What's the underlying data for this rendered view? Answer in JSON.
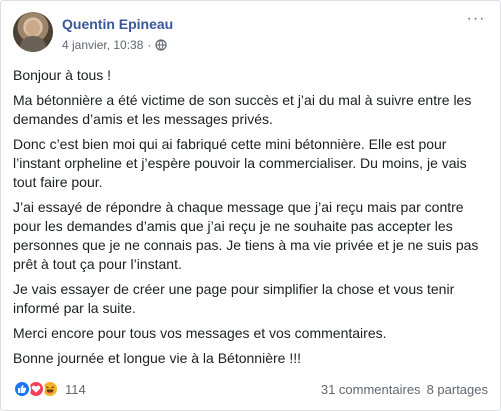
{
  "post": {
    "author": "Quentin Epineau",
    "date": "4 janvier, 10:38",
    "separator": "·",
    "privacy_icon": "globe-icon",
    "more_icon": "more-options-icon",
    "more_label": "···",
    "paragraphs": [
      "Bonjour à tous !",
      "Ma bétonnière a été victime de son succès et j’ai du mal à suivre entre les demandes d’amis et les messages privés.",
      "Donc c’est bien moi qui ai fabriqué cette mini bétonnière. Elle est pour l’instant orpheline et j’espère pouvoir la commercialiser. Du moins, je vais tout faire pour.",
      "J’ai essayé de répondre à chaque message que j’ai reçu mais par contre pour les demandes d’amis que j’ai reçu je ne souhaite pas accepter les personnes que je ne connais pas. Je tiens à ma vie privée et je ne suis pas prêt à tout ça pour l’instant.",
      "Je vais essayer de créer une page pour simplifier la chose et vous tenir informé par la suite.",
      "Merci encore pour tous vos messages et vos commentaires.",
      "Bonne journée et longue vie à la Bétonnière !!!"
    ]
  },
  "reactions": {
    "icons": [
      "like-icon",
      "love-icon",
      "haha-icon"
    ],
    "colors": {
      "like": "#1877f2",
      "love": "#f33e58",
      "haha": "#f7b125"
    },
    "count": "114"
  },
  "stats": {
    "comments": "31 commentaires",
    "shares": "8 partages"
  },
  "colors": {
    "author": "#385898",
    "meta": "#606770"
  }
}
